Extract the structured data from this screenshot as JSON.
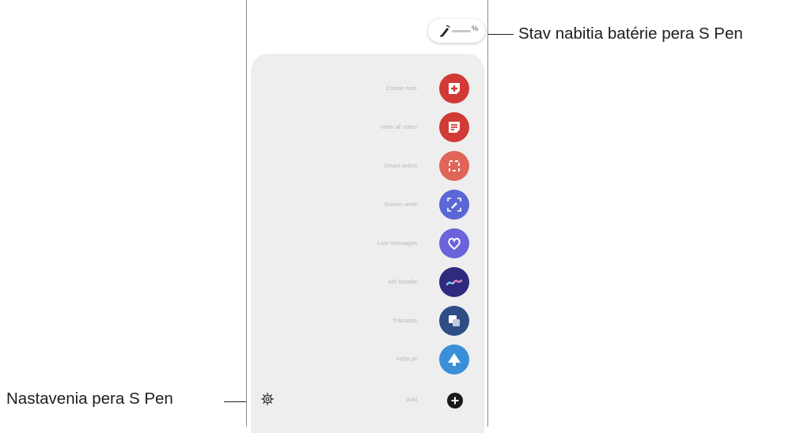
{
  "callouts": {
    "battery_label": "Stav nabitia batérie pera S Pen",
    "settings_label": "Nastavenia pera S Pen"
  },
  "battery": {
    "percent_symbol": "%"
  },
  "menu": {
    "items": [
      {
        "label": "Create note",
        "icon": "create-note-icon",
        "color": "#d13a35"
      },
      {
        "label": "View all notes",
        "icon": "view-all-notes-icon",
        "color": "#d13a35"
      },
      {
        "label": "Smart select",
        "icon": "smart-select-icon",
        "color": "#e06458"
      },
      {
        "label": "Screen write",
        "icon": "screen-write-icon",
        "color": "#5b67d6"
      },
      {
        "label": "Live messages",
        "icon": "live-messages-icon",
        "color": "#6a63dc"
      },
      {
        "label": "AR Doodle",
        "icon": "ar-doodle-icon",
        "color": "#2f2a7e"
      },
      {
        "label": "Translate",
        "icon": "translate-icon",
        "color": "#2e4d86"
      },
      {
        "label": "PENUP",
        "icon": "penup-icon",
        "color": "#3a8fd9"
      },
      {
        "label": "Add",
        "icon": "add-icon",
        "color": "#1a1a1a"
      }
    ]
  }
}
